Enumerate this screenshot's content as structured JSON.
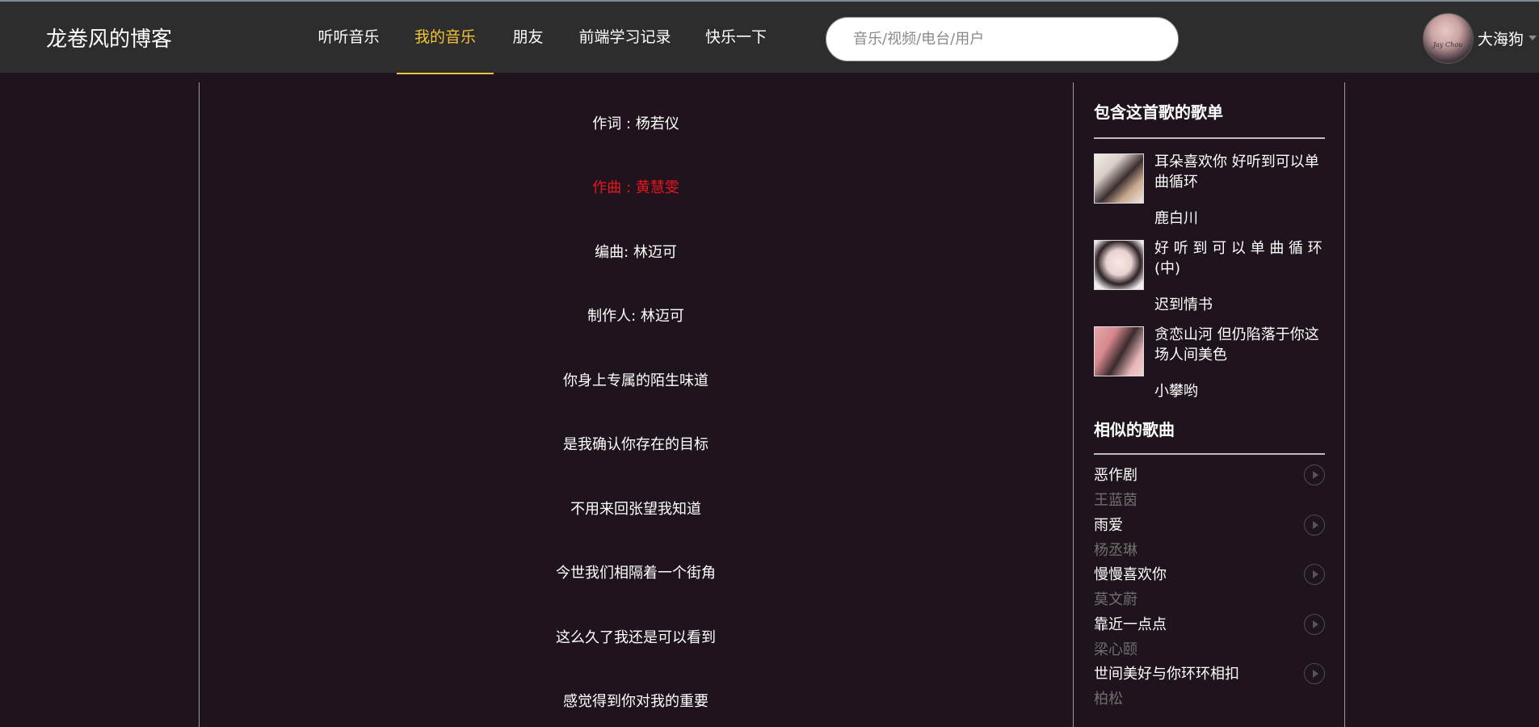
{
  "header": {
    "logo": "龙卷风的博客",
    "nav": [
      {
        "label": "听听音乐",
        "active": false
      },
      {
        "label": "我的音乐",
        "active": true
      },
      {
        "label": "朋友",
        "active": false
      },
      {
        "label": "前端学习记录",
        "active": false
      },
      {
        "label": "快乐一下",
        "active": false
      }
    ],
    "search_placeholder": "音乐/视频/电台/用户",
    "avatar_signature": "Jay Chou",
    "username": "大海狗",
    "accent_color": "#f3c433"
  },
  "lyrics": {
    "current_color": "#e8141e",
    "lines": [
      {
        "text": "作词 : 杨若仪",
        "current": false
      },
      {
        "text": "作曲 : 黄慧雯",
        "current": true
      },
      {
        "text": "编曲:  林迈可",
        "current": false
      },
      {
        "text": "制作人:  林迈可",
        "current": false
      },
      {
        "text": "你身上专属的陌生味道",
        "current": false
      },
      {
        "text": "是我确认你存在的目标",
        "current": false
      },
      {
        "text": "不用来回张望我知道",
        "current": false
      },
      {
        "text": "今世我们相隔着一个街角",
        "current": false
      },
      {
        "text": "这么久了我还是可以看到",
        "current": false
      },
      {
        "text": "感觉得到你对我的重要",
        "current": false
      }
    ]
  },
  "sidebar": {
    "playlists_title": "包含这首歌的歌单",
    "playlists": [
      {
        "name": "耳朵喜欢你 好听到可以单曲循环",
        "author": "鹿白川"
      },
      {
        "name": "好 听 到 可 以 单 曲 循 环 (中)",
        "author": "迟到情书"
      },
      {
        "name": "贪恋山河 但仍陷落于你这场人间美色",
        "author": "小攀哟"
      }
    ],
    "similar_title": "相似的歌曲",
    "similar_songs": [
      {
        "name": "恶作剧",
        "artist": "王蓝茵"
      },
      {
        "name": "雨爱",
        "artist": "杨丞琳"
      },
      {
        "name": "慢慢喜欢你",
        "artist": "莫文蔚"
      },
      {
        "name": "靠近一点点",
        "artist": "梁心颐"
      },
      {
        "name": "世间美好与你环环相扣",
        "artist": "柏松"
      }
    ]
  }
}
